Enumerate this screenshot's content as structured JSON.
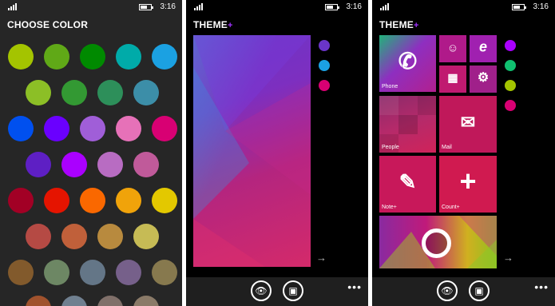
{
  "screen1": {
    "status": {
      "time": "3:16"
    },
    "title": "CHOOSE COLOR",
    "swatches": [
      [
        "#a4c400",
        "#60a917",
        "#008a00",
        "#00aba9",
        "#1ba1e2"
      ],
      [
        "#8cbf26",
        "#339933",
        "#2d8f5a",
        "#3c8ea8"
      ],
      [
        "#0050ef",
        "#6a00ff",
        "#a05ed8",
        "#e671b8",
        "#d80073"
      ],
      [
        "#5e1fc4",
        "#aa00ff",
        "#b86cc2",
        "#c05a9a"
      ],
      [
        "#a20025",
        "#e51400",
        "#fa6800",
        "#f0a30a",
        "#e3c800"
      ],
      [
        "#b54a44",
        "#c0603a",
        "#b88a3e",
        "#c6bb55"
      ],
      [
        "#825a2c",
        "#6d8764",
        "#647687",
        "#76608a",
        "#87794e"
      ],
      [
        "#a0522d",
        "#708090",
        "#80706a",
        "#8a7a68"
      ]
    ]
  },
  "screen2": {
    "status": {
      "time": "3:16"
    },
    "title": "THEME",
    "title_plus": "+",
    "dots": [
      "#6a35c8",
      "#1ba1e2",
      "#d80073"
    ],
    "arrow": "→",
    "appbar": {
      "view_icon": "eye-icon",
      "save_icon": "save-icon",
      "more": "•••"
    }
  },
  "screen3": {
    "status": {
      "time": "3:16"
    },
    "title": "THEME",
    "title_plus": "+",
    "tiles": {
      "phone": "Phone",
      "people": "People",
      "mail": "Mail",
      "note": "Note+",
      "count": "Count+"
    },
    "dots": [
      "#aa00ff",
      "#10c070",
      "#a4c400",
      "#d80073"
    ],
    "arrow": "→",
    "appbar": {
      "view_icon": "eye-icon",
      "save_icon": "save-icon",
      "more": "•••"
    }
  }
}
